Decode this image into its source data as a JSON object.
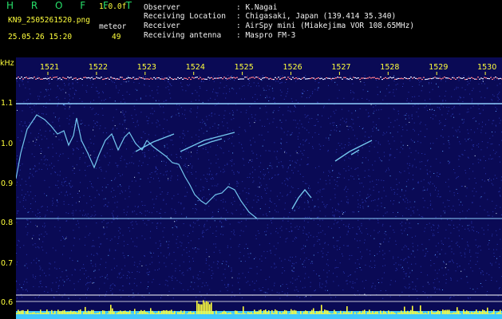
{
  "app": {
    "logo_text": "H R O F F T",
    "version": "1.0.0f",
    "filename": "KN9_2505261520.png",
    "datetime": "25.05.26 15:20",
    "meteor_label": "meteor",
    "meteor_count": "49"
  },
  "info": {
    "rows": [
      {
        "label": "Observer",
        "value": ": K.Nagai"
      },
      {
        "label": "Receiving Location",
        "value": ": Chigasaki, Japan (139.414 35.340)"
      },
      {
        "label": "Receiver",
        "value": ": AirSpy mini (Miakejima VOR 108.65MHz)"
      },
      {
        "label": "Receiving antenna",
        "value": ": Maspro FM-3"
      }
    ]
  },
  "spectrogram": {
    "y_unit": "kHz",
    "x_ticks": [
      "1521",
      "1522",
      "1523",
      "1524",
      "1525",
      "1526",
      "1527",
      "1528",
      "1529",
      "1530"
    ],
    "y_ticks": [
      "1.1",
      "1.0",
      "0.9",
      "0.8",
      "0.7",
      "0.6"
    ],
    "colors": {
      "background": "#0a0a55",
      "noise": "#2a38b0",
      "trace": "#7fdcff",
      "reference_line": "#8fd0ff",
      "histogram": "#ffff3c",
      "histogram_base": "#3fc8ff"
    }
  }
}
